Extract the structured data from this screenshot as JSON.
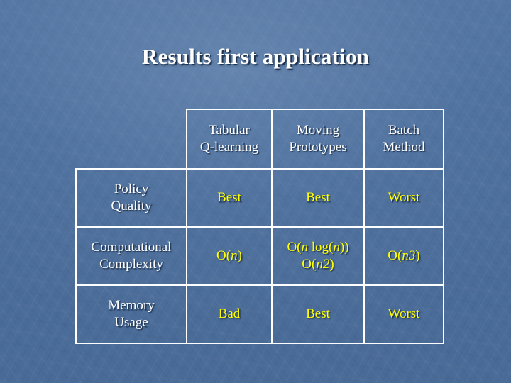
{
  "slide": {
    "background_color": "#4c6e9b",
    "title": "Results first application",
    "title_color": "#ffffff",
    "value_color": "#ffff00",
    "border_color": "#ffffff"
  },
  "table": {
    "corner_label": "",
    "headers": [
      {
        "line1": "Tabular",
        "line2": "Q-learning"
      },
      {
        "line1": "Moving",
        "line2": "Prototypes"
      },
      {
        "line1": "Batch",
        "line2": "Method"
      }
    ],
    "rows": [
      {
        "label_line1": "Policy",
        "label_line2": "Quality",
        "cells": [
          {
            "line1": "Best",
            "line2": ""
          },
          {
            "line1": "Best",
            "line2": ""
          },
          {
            "line1": "Worst",
            "line2": ""
          }
        ]
      },
      {
        "label_line1": "Computational",
        "label_line2": "Complexity",
        "cells": [
          {
            "line1": "O(n)",
            "line2": ""
          },
          {
            "line1": "O(n log(n))",
            "line2": "O(n2)"
          },
          {
            "line1": "O(n3)",
            "line2": ""
          }
        ]
      },
      {
        "label_line1": "Memory",
        "label_line2": "Usage",
        "cells": [
          {
            "line1": "Bad",
            "line2": ""
          },
          {
            "line1": "Best",
            "line2": ""
          },
          {
            "line1": "Worst",
            "line2": ""
          }
        ]
      }
    ]
  }
}
